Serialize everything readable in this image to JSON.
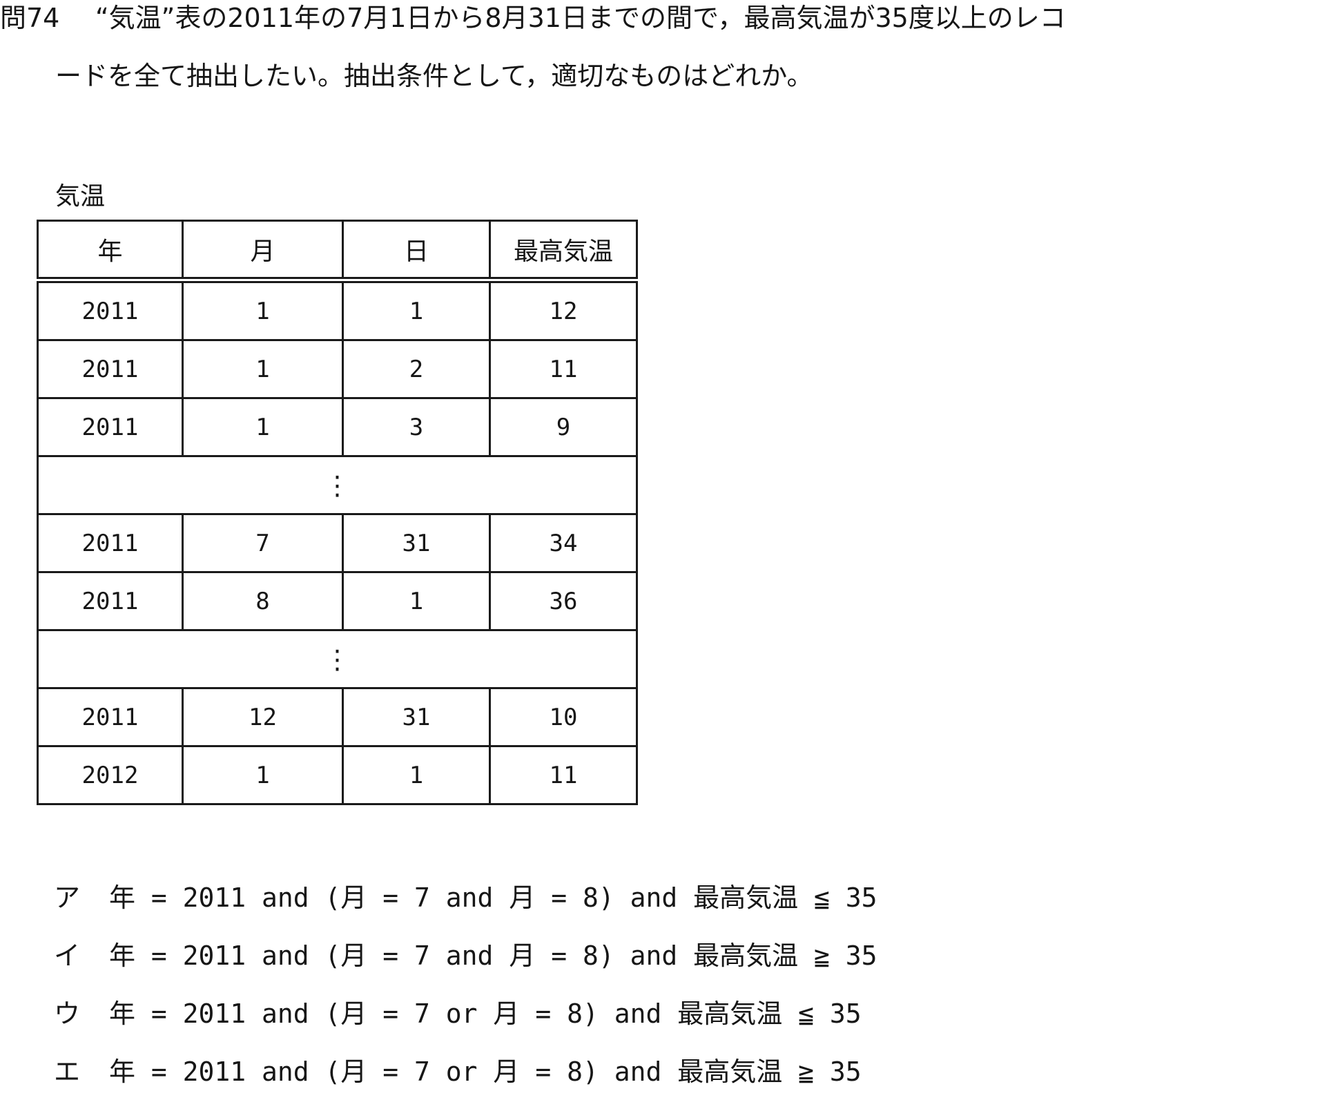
{
  "question": {
    "number": "問74",
    "line1": "“気温”表の2011年の7月1日から8月31日までの間で，最高気温が35度以上のレコ",
    "line2": "ードを全て抽出したい。抽出条件として，適切なものはどれか。"
  },
  "table": {
    "caption": "気温",
    "headers": [
      "年",
      "月",
      "日",
      "最高気温"
    ],
    "rows": [
      [
        "2011",
        "1",
        "1",
        "12"
      ],
      [
        "2011",
        "1",
        "2",
        "11"
      ],
      [
        "2011",
        "1",
        "3",
        "9"
      ],
      [
        "2011",
        "7",
        "31",
        "34"
      ],
      [
        "2011",
        "8",
        "1",
        "36"
      ],
      [
        "2011",
        "12",
        "31",
        "10"
      ],
      [
        "2012",
        "1",
        "1",
        "11"
      ]
    ],
    "ellipsis": "⋮"
  },
  "choices": [
    {
      "letter": "ア",
      "expr": "年 = 2011 and (月 = 7 and 月 = 8) and 最高気温 ≦ 35"
    },
    {
      "letter": "イ",
      "expr": "年 = 2011 and (月 = 7 and 月 = 8) and 最高気温 ≧ 35"
    },
    {
      "letter": "ウ",
      "expr": "年 = 2011 and (月 = 7 or 月 = 8) and 最高気温 ≦ 35"
    },
    {
      "letter": "エ",
      "expr": "年 = 2011 and (月 = 7 or 月 = 8) and 最高気温 ≧ 35"
    }
  ]
}
